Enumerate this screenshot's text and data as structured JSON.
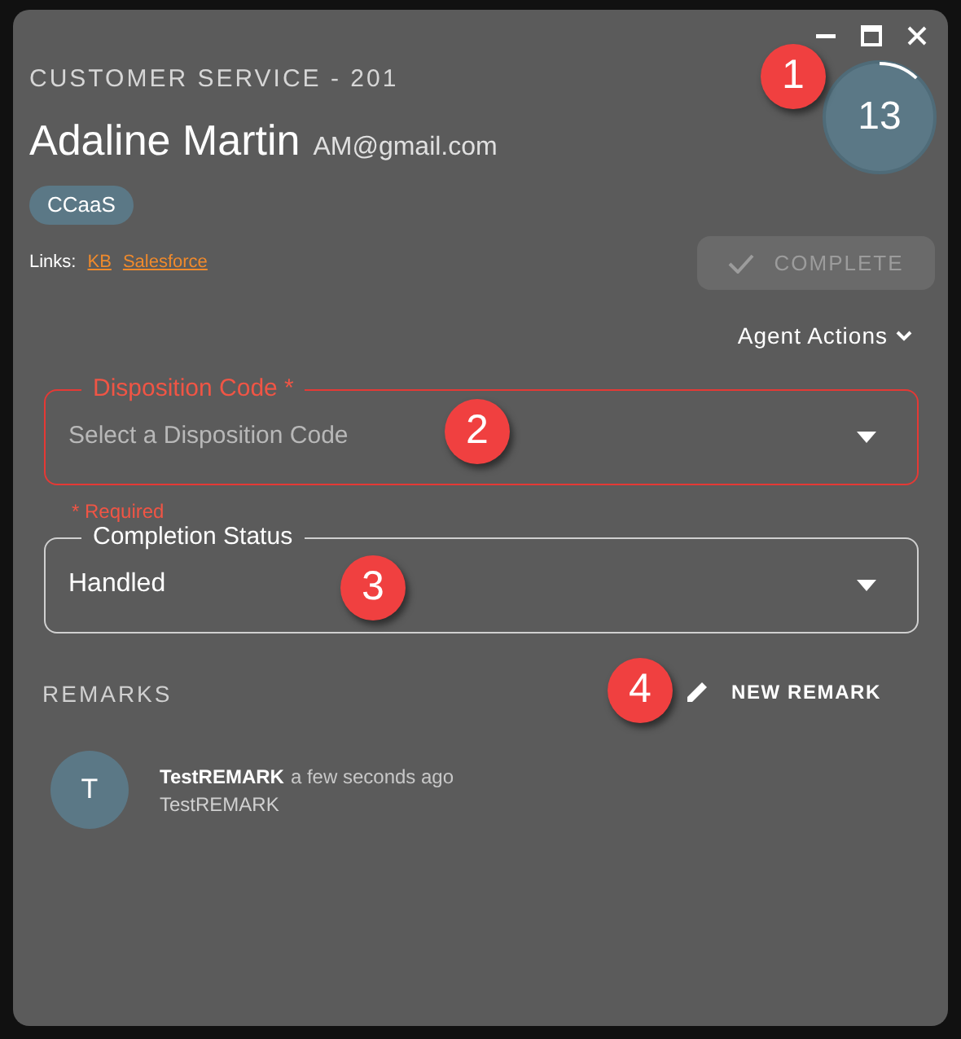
{
  "queue_title": "CUSTOMER SERVICE - 201",
  "customer": {
    "name": "Adaline Martin",
    "email": "AM@gmail.com"
  },
  "tags": [
    "CCaaS"
  ],
  "links": {
    "label": "Links:",
    "items": [
      "KB",
      "Salesforce"
    ]
  },
  "timer": {
    "value": "13"
  },
  "complete_button": {
    "label": "COMPLETE",
    "disabled": true
  },
  "agent_actions": "Agent Actions",
  "fields": [
    {
      "label": "Disposition Code *",
      "placeholder": "Select a Disposition Code",
      "error": true,
      "helper": "* Required"
    },
    {
      "label": "Completion Status",
      "value": "Handled",
      "error": false
    }
  ],
  "remarks": {
    "title": "REMARKS",
    "new_button": "NEW REMARK",
    "items": [
      {
        "initial": "T",
        "author": "TestREMARK",
        "time": "a few seconds ago",
        "text": "TestREMARK"
      }
    ]
  },
  "callouts": [
    "1",
    "2",
    "3",
    "4"
  ]
}
